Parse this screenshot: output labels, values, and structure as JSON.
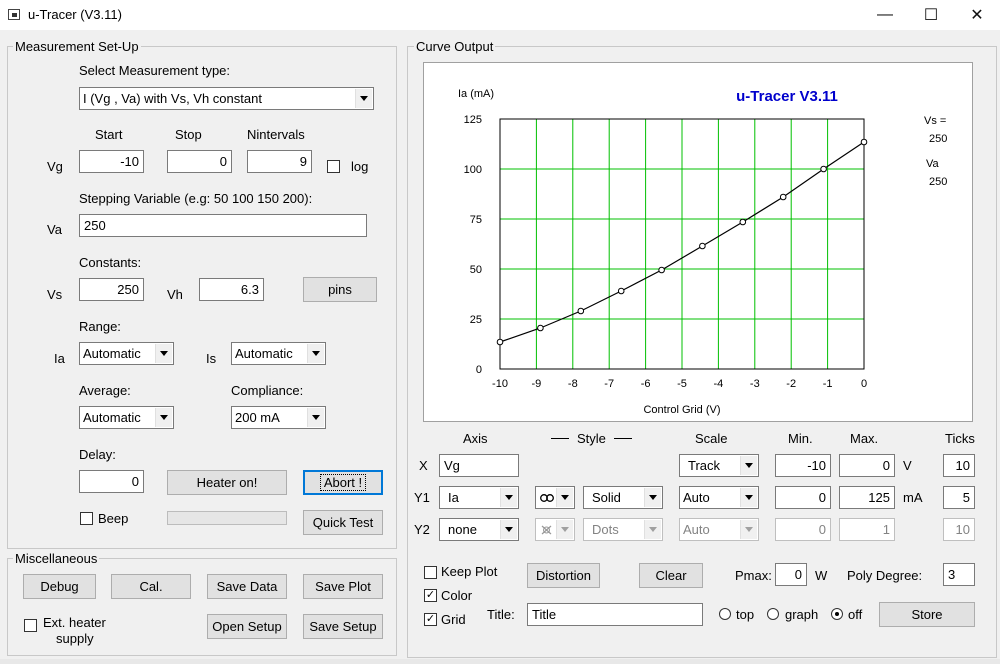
{
  "window": {
    "title": "u-Tracer (V3.11)",
    "minimize_glyph": "—",
    "maximize_glyph": "☐",
    "close_glyph": "✕"
  },
  "setup": {
    "group_label": "Measurement Set-Up",
    "measurement_type_label": "Select Measurement type:",
    "measurement_type_value": "I (Vg , Va) with Vs, Vh constant",
    "start_label": "Start",
    "stop_label": "Stop",
    "nintervals_label": "Nintervals",
    "vg_label": "Vg",
    "vg_start": "-10",
    "vg_stop": "0",
    "vg_nintervals": "9",
    "log_label": "log",
    "log_checked": false,
    "stepping_label": "Stepping Variable (e.g: 50 100 150 200):",
    "va_label": "Va",
    "va_value": "250",
    "constants_label": "Constants:",
    "vs_label": "Vs",
    "vs_value": "250",
    "vh_label": "Vh",
    "vh_value": "6.3",
    "pins_label": "pins",
    "range_label": "Range:",
    "ia_label": "Ia",
    "ia_range": "Automatic",
    "is_label": "Is",
    "is_range": "Automatic",
    "average_label": "Average:",
    "average_value": "Automatic",
    "compliance_label": "Compliance:",
    "compliance_value": "200 mA",
    "delay_label": "Delay:",
    "delay_value": "0",
    "heater_label": "Heater on!",
    "abort_label": "Abort !",
    "beep_label": "Beep",
    "beep_checked": false,
    "quicktest_label": "Quick Test"
  },
  "misc": {
    "group_label": "Miscellaneous",
    "debug_label": "Debug",
    "cal_label": "Cal.",
    "save_data_label": "Save Data",
    "save_plot_label": "Save Plot",
    "ext_heater_label_1": "Ext. heater",
    "ext_heater_label_2": "supply",
    "ext_heater_checked": false,
    "open_setup_label": "Open Setup",
    "save_setup_label": "Save Setup"
  },
  "curve": {
    "group_label": "Curve Output",
    "info": {
      "vs_label": "Vs =",
      "vs_value": "250",
      "va_label": "Va",
      "va_value": "250"
    }
  },
  "chart_data": {
    "type": "line",
    "title": "u-Tracer V3.11",
    "xlabel": "Control Grid (V)",
    "ylabel": "Ia (mA)",
    "xlim": [
      -10,
      0
    ],
    "ylim": [
      0,
      125
    ],
    "x_ticks": [
      "-10",
      "-9",
      "-8",
      "-7",
      "-6",
      "-5",
      "-4",
      "-3",
      "-2",
      "-1",
      "0"
    ],
    "y_ticks": [
      "0",
      "25",
      "50",
      "75",
      "100",
      "125"
    ],
    "grid": true,
    "grid_color": "#00c000",
    "line_color": "#000000",
    "title_color": "#0000cc",
    "series": [
      {
        "x": [
          -10,
          -8.89,
          -7.78,
          -6.67,
          -5.56,
          -4.44,
          -3.33,
          -2.22,
          -1.11,
          0
        ],
        "y": [
          13.5,
          20.5,
          29,
          39,
          49.5,
          61.5,
          73.5,
          86,
          100,
          113.5
        ]
      }
    ]
  },
  "axes": {
    "axis_header": "Axis",
    "style_header": "Style",
    "scale_header": "Scale",
    "min_header": "Min.",
    "max_header": "Max.",
    "ticks_header": "Ticks",
    "x": {
      "row_label": "X",
      "var": "Vg",
      "scale": "Track",
      "min": "-10",
      "max": "0",
      "unit": "V",
      "ticks": "10"
    },
    "y1": {
      "row_label": "Y1",
      "var": "Ia",
      "marker_icon": "circle-marker-icon",
      "style": "Solid",
      "scale": "Auto",
      "min": "0",
      "max": "125",
      "unit": "mA",
      "ticks": "5"
    },
    "y2": {
      "row_label": "Y2",
      "var": "none",
      "marker_icon": "marker-icon",
      "style": "Dots",
      "scale": "Auto",
      "min": "0",
      "max": "1",
      "ticks": "10"
    }
  },
  "options": {
    "keep_plot_label": "Keep Plot",
    "keep_plot_checked": false,
    "color_label": "Color",
    "color_checked": true,
    "grid_label": "Grid",
    "grid_checked": true,
    "distortion_label": "Distortion",
    "clear_label": "Clear",
    "pmax_label": "Pmax:",
    "pmax_value": "0",
    "pmax_unit": "W",
    "poly_label": "Poly Degree:",
    "poly_value": "3",
    "title_label": "Title:",
    "title_value": "Title",
    "pos_top_label": "top",
    "pos_graph_label": "graph",
    "pos_off_label": "off",
    "pos_selected": "off",
    "store_label": "Store"
  }
}
